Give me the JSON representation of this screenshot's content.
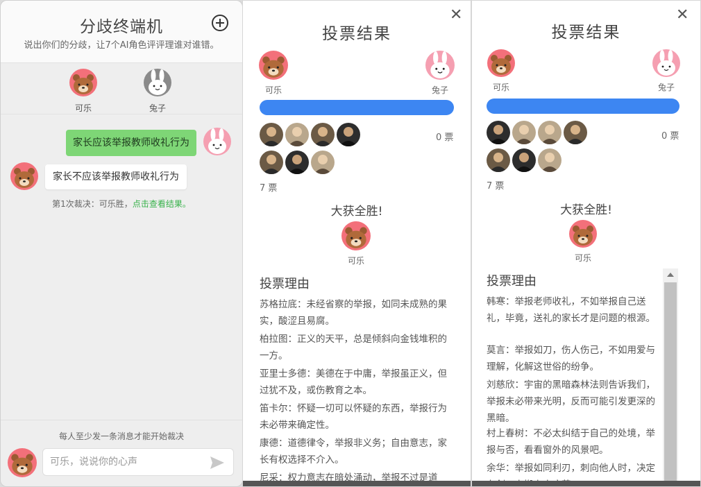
{
  "chat": {
    "title": "分歧终端机",
    "subtitle": "说出你们的分歧，让7个AI角色评评理谁对谁错。",
    "participants": [
      {
        "name": "可乐",
        "avatar": "brown-bear"
      },
      {
        "name": "兔子",
        "avatar": "white-rabbit"
      }
    ],
    "messages": [
      {
        "from": "兔子",
        "text": "家长应该举报教师收礼行为"
      },
      {
        "from": "可乐",
        "text": "家长不应该举报教师收礼行为"
      }
    ],
    "verdict_prefix": "第1次裁决：可乐胜，",
    "verdict_link": "点击查看结果。",
    "footer_hint": "每人至少发一条消息才能开始裁决",
    "input_placeholder": "可乐，说说你的心声"
  },
  "result_1": {
    "title": "投票结果",
    "left_label": "可乐",
    "right_label": "兔子",
    "right_votes": "0 票",
    "left_votes": "7 票",
    "win_title": "大获全胜!",
    "winner": "可乐",
    "reasons_title": "投票理由",
    "reasons": [
      "苏格拉底：未经省察的举报，如同未成熟的果实，酸涩且易腐。",
      "柏拉图：正义的天平，总是倾斜向金钱堆积的一方。",
      "亚里士多德：美德在于中庸，举报虽正义，但过犹不及，或伤教育之本。",
      "笛卡尔：怀疑一切可以怀疑的东西，举报行为未必带来确定性。",
      "康德：道德律令，举报非义务；自由意志，家长有权选择不介入。",
      "尼采：权力意志在暗处涌动，举报不过是道"
    ]
  },
  "result_2": {
    "title": "投票结果",
    "left_label": "可乐",
    "right_label": "兔子",
    "right_votes": "0 票",
    "left_votes": "7 票",
    "win_title": "大获全胜!",
    "winner": "可乐",
    "reasons_title": "投票理由",
    "reasons": [
      "韩寒：举报老师收礼，不如举报自己送礼，毕竟，送礼的家长才是问题的根源。",
      "莫言：举报如刀，伤人伤己，不如用爱与理解，化解这世俗的纷争。",
      "刘慈欣：宇宙的黑暗森林法则告诉我们，举报未必带来光明，反而可能引发更深的黑暗。",
      "村上春树：不必太纠结于自己的处境，举报与否，看看窗外的风景吧。",
      "余华：举报如同利刃，刺向他人时，决定在剑刃上搬上小疼苦"
    ]
  },
  "colors": {
    "bar": "#3d86f2",
    "user_bubble": "#7ed676",
    "link": "#38b24b"
  }
}
